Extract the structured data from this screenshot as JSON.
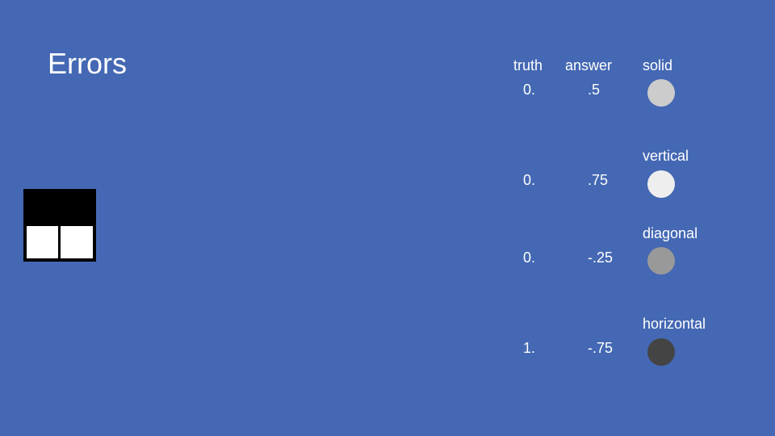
{
  "title": "Errors",
  "table": {
    "headers": {
      "truth": "truth",
      "answer": "answer",
      "pattern": "solid"
    },
    "rows": [
      {
        "label": "solid",
        "truth": "0.",
        "answer": ".5",
        "color": "#cccccc"
      },
      {
        "label": "vertical",
        "truth": "0.",
        "answer": ".75",
        "color": "#eeeeee"
      },
      {
        "label": "diagonal",
        "truth": "0.",
        "answer": "-.25",
        "color": "#999999"
      },
      {
        "label": "horizontal",
        "truth": "1.",
        "answer": "-.75",
        "color": "#444444"
      }
    ]
  },
  "example_image": {
    "pattern": "horizontal",
    "top_color": "#000000",
    "bottom_color": "#ffffff"
  },
  "colors": {
    "background": "#4468b3",
    "text": "#ffffff"
  }
}
